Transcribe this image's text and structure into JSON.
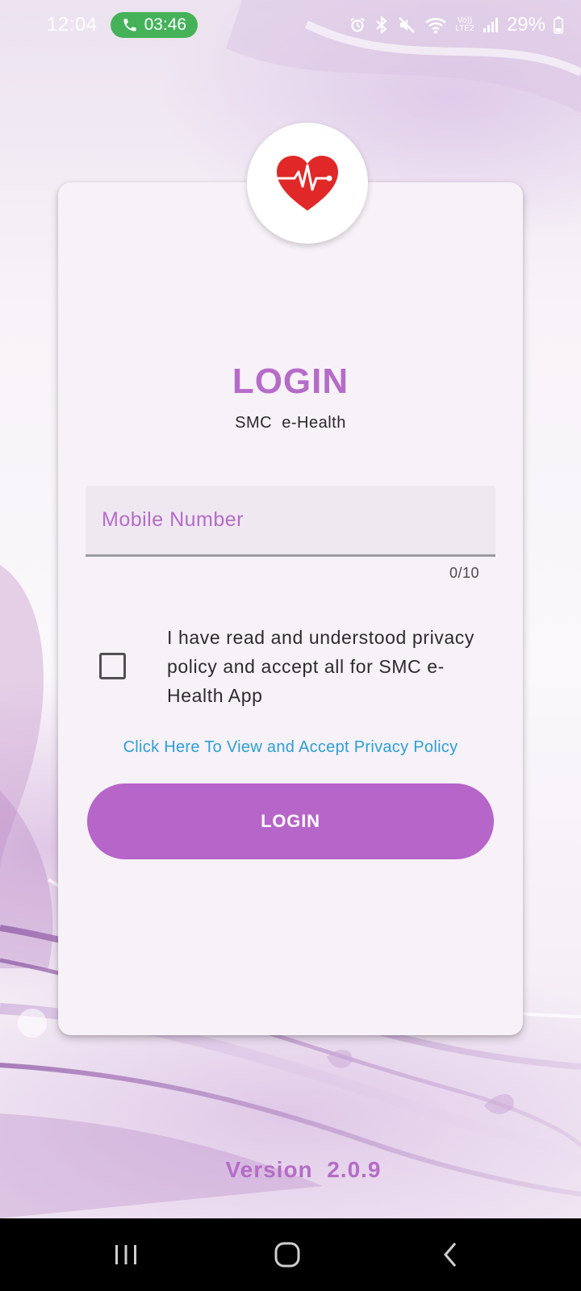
{
  "status_bar": {
    "time": "12:04",
    "call_duration": "03:46",
    "network_label": "Vo)) LTE2",
    "battery": "29%",
    "icons": [
      "alarm-icon",
      "bluetooth-icon",
      "mute-icon",
      "wifi-icon",
      "signal-icon",
      "battery-icon"
    ]
  },
  "login": {
    "title": "LOGIN",
    "subtitle": "SMC  e-Health",
    "mobile_placeholder": "Mobile Number",
    "mobile_value": "",
    "counter": "0/10",
    "consent_checked": false,
    "consent_text": "I have read and understood privacy policy and accept all for SMC e-Health App",
    "policy_link": "Click Here To View and Accept Privacy Policy",
    "button_label": "LOGIN",
    "logo_icon": "heart-pulse-icon"
  },
  "footer": {
    "version": "Version  2.0.9"
  },
  "nav_bar": {
    "icons": [
      "recent-apps-icon",
      "home-icon",
      "back-icon"
    ]
  },
  "colors": {
    "accent": "#b665c8",
    "title": "#b56cc7",
    "link": "#2d9fd3",
    "call_pill": "#45b25a",
    "heart": "#e02828"
  }
}
